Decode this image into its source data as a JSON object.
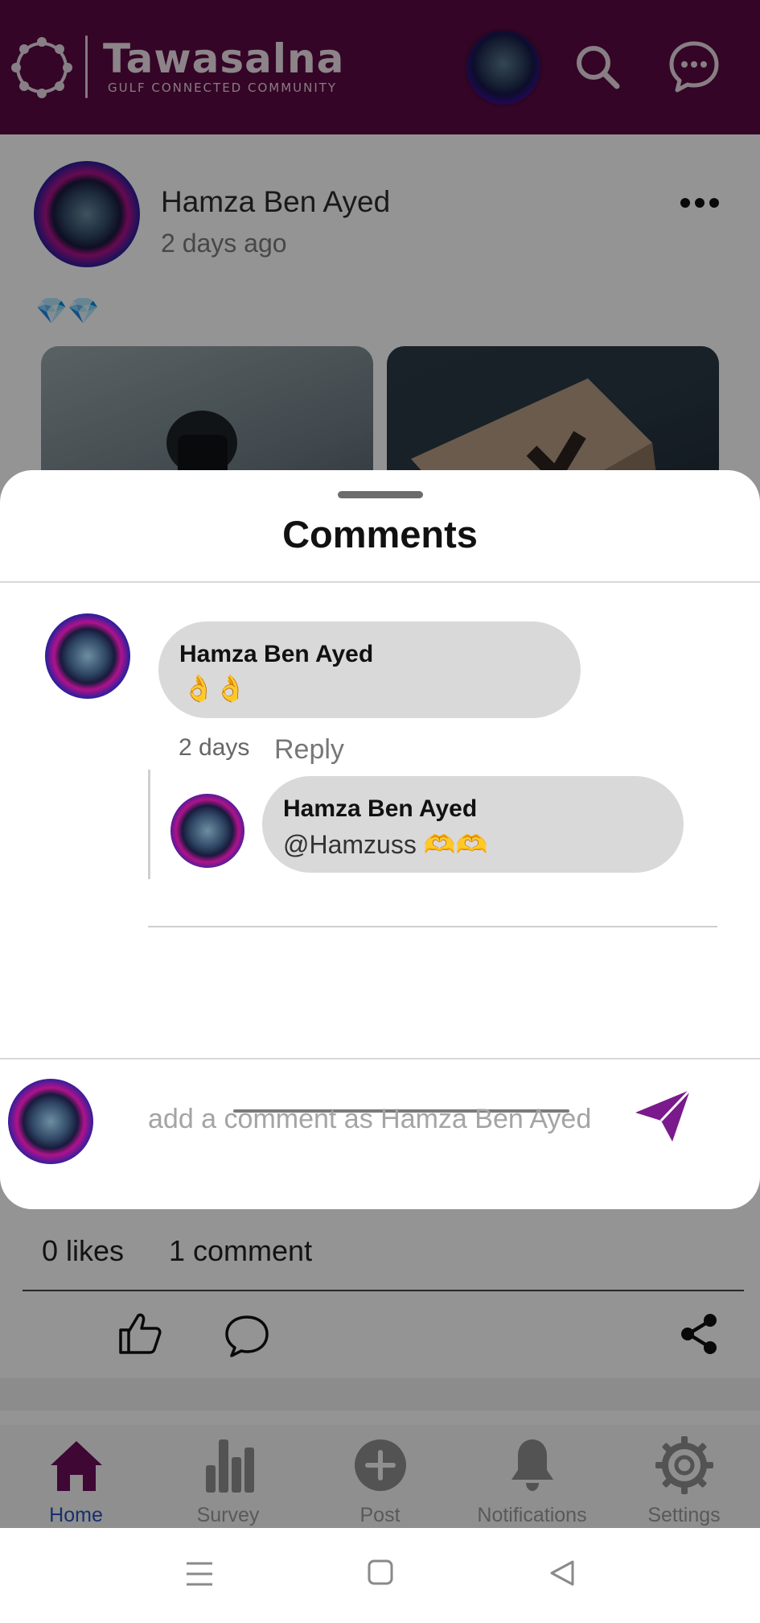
{
  "header": {
    "app_name": "Tawasalna",
    "tagline": "GULF CONNECTED COMMUNITY",
    "icons": [
      "logo-ring-icon",
      "search-icon",
      "chat-bubble-icon"
    ],
    "colors": {
      "header_bg": "#5b0a43",
      "accent": "#7a1a8c"
    }
  },
  "post": {
    "author": "Hamza Ben Ayed",
    "time": "2 days ago",
    "content_emoji": "💎💎",
    "likes_label": "0 likes",
    "comments_label": "1 comment"
  },
  "comments_sheet": {
    "title": "Comments",
    "comment": {
      "author": "Hamza Ben Ayed",
      "text": "👌👌",
      "time": "2 days",
      "reply_label": "Reply"
    },
    "reply": {
      "author": "Hamza Ben Ayed",
      "text": "@Hamzuss 🫶🫶"
    },
    "input": {
      "placeholder": "add a comment as Hamza Ben Ayed",
      "value": ""
    }
  },
  "bottom_nav": {
    "items": [
      {
        "label": "Home",
        "icon": "home-icon",
        "active": true
      },
      {
        "label": "Survey",
        "icon": "bar-chart-icon",
        "active": false
      },
      {
        "label": "Post",
        "icon": "plus-circle-icon",
        "active": false
      },
      {
        "label": "Notifications",
        "icon": "bell-icon",
        "active": false
      },
      {
        "label": "Settings",
        "icon": "gear-icon",
        "active": false
      }
    ]
  }
}
